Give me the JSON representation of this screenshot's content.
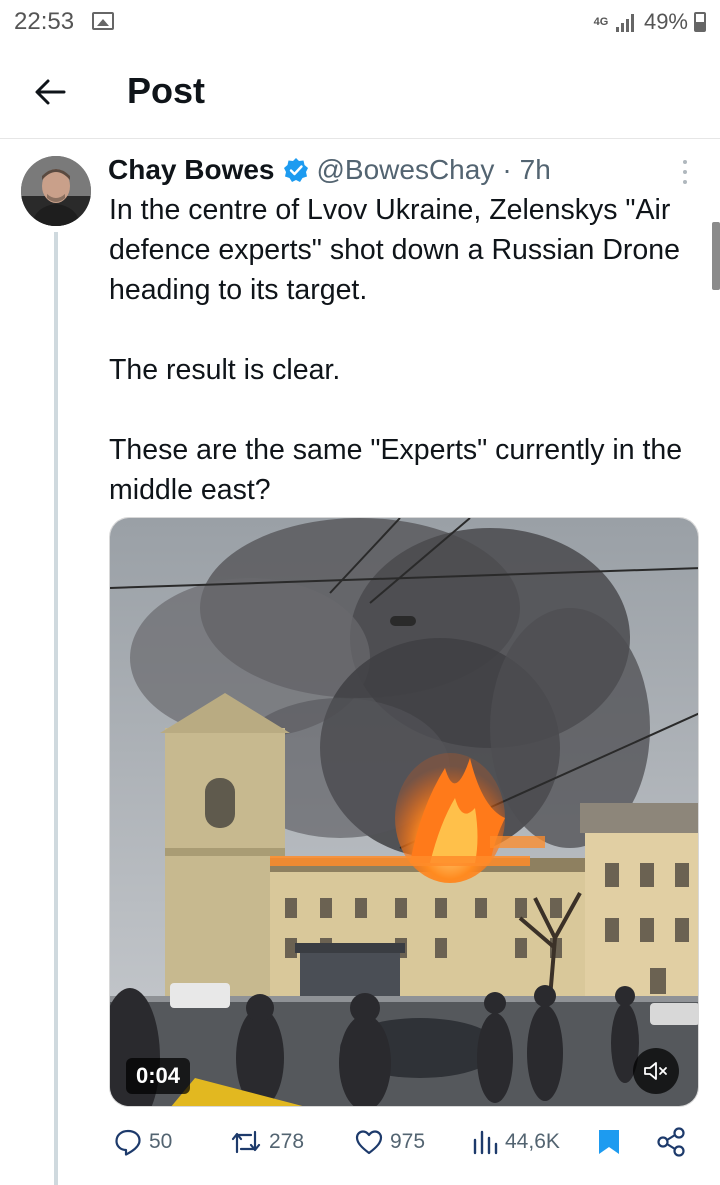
{
  "status_bar": {
    "time": "22:53",
    "network_type": "4G",
    "battery_percent": "49%",
    "battery_level": 0.49,
    "icons": [
      "image-icon",
      "signal-icon",
      "battery-icon"
    ]
  },
  "header": {
    "title": "Post",
    "back_icon": "arrow-left-icon"
  },
  "post": {
    "author_name": "Chay Bowes",
    "verified": true,
    "handle": "@BowesChay",
    "separator": "·",
    "time_ago": "7h",
    "paragraphs": [
      "In the centre of Lvov Ukraine, Zelenskys \"Air defence experts\" shot down a Russian Drone heading to its target.",
      "The result is clear.",
      "These are the same \"Experts\" currently in the middle east?"
    ],
    "media": {
      "type": "video",
      "duration": "0:04",
      "muted": true
    },
    "actions": {
      "replies": "50",
      "reposts": "278",
      "likes": "975",
      "views": "44,6K",
      "bookmarked": true
    }
  },
  "colors": {
    "text_primary": "#0f1419",
    "text_secondary": "#536471",
    "accent": "#1d9bf0",
    "verified": "#1d9bf0",
    "fire": "#ff7a1a",
    "smoke": "#4a4a4e"
  }
}
